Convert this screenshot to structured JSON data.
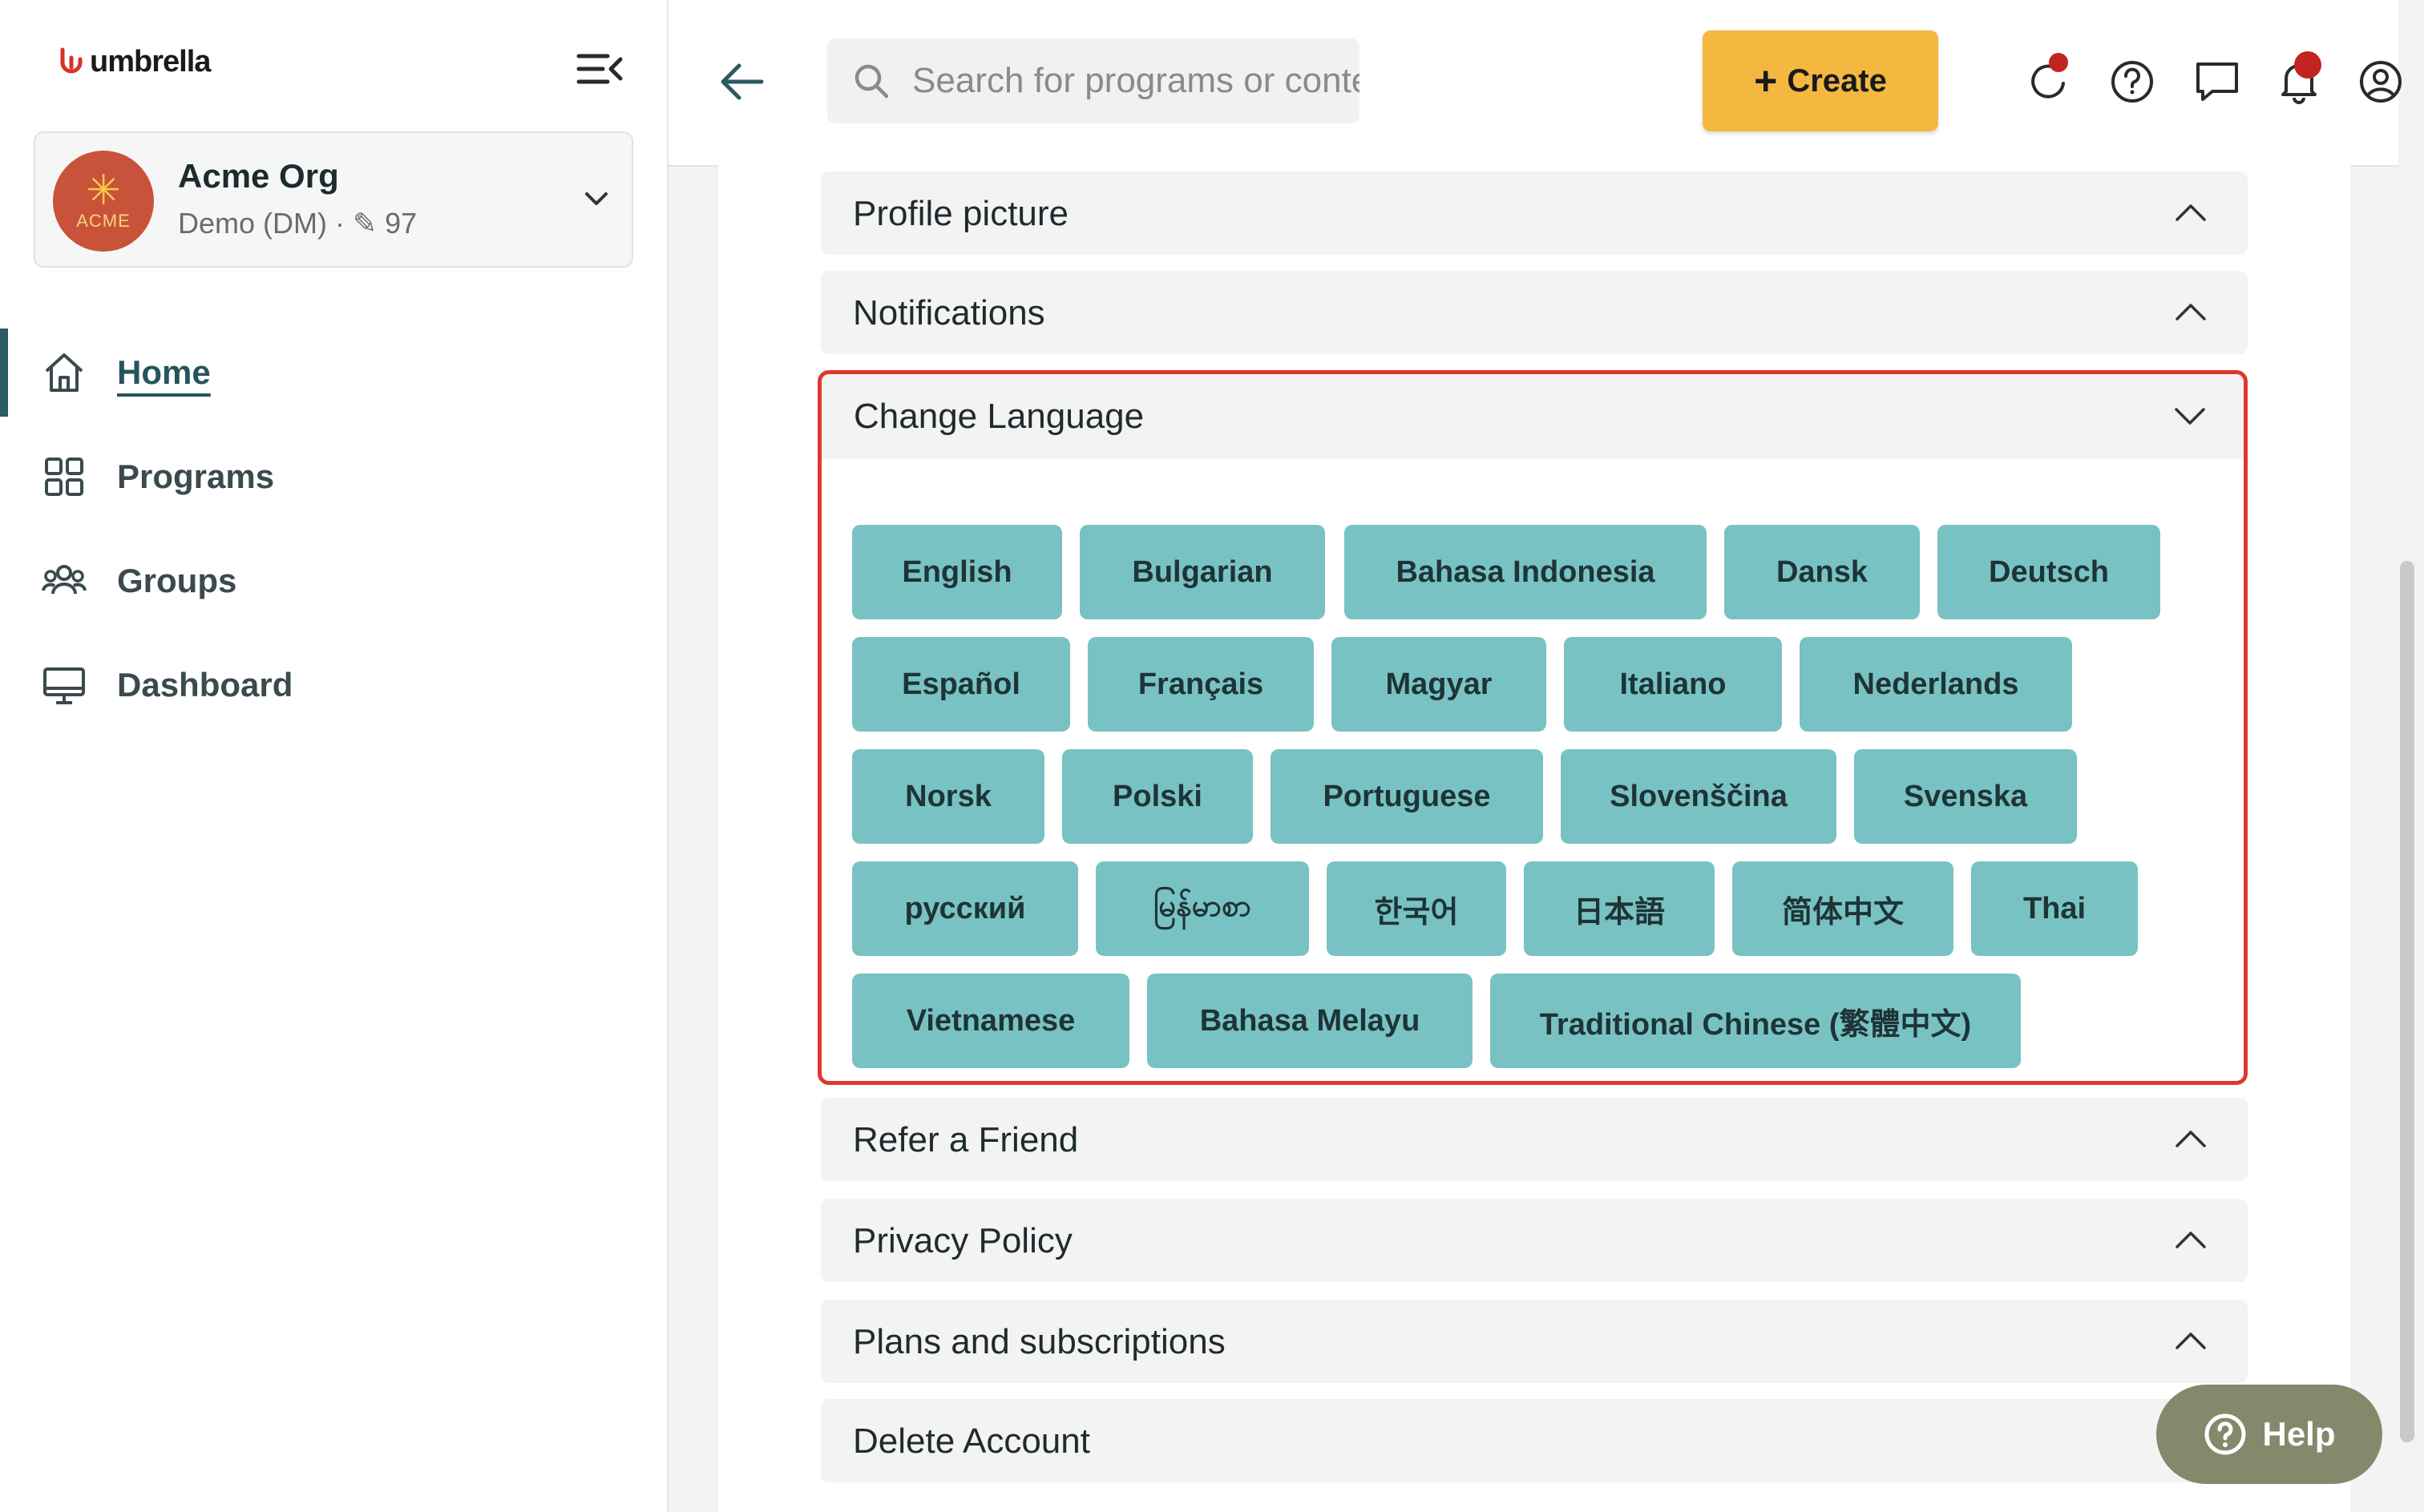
{
  "brand": {
    "name": "umbrella"
  },
  "org": {
    "name": "Acme Org",
    "avatar_text": "ACME",
    "subtitle": "Demo (DM) · ✎ 97"
  },
  "nav": {
    "items": [
      {
        "label": "Home",
        "icon": "home-icon",
        "active": true
      },
      {
        "label": "Programs",
        "icon": "grid-icon",
        "active": false
      },
      {
        "label": "Groups",
        "icon": "users-icon",
        "active": false
      },
      {
        "label": "Dashboard",
        "icon": "monitor-icon",
        "active": false
      }
    ]
  },
  "topbar": {
    "search_placeholder": "Search for programs or content",
    "create_label": "Create",
    "icons": [
      "refresh-icon",
      "help-circle-icon",
      "chat-icon",
      "bell-icon",
      "user-circle-icon"
    ]
  },
  "sections": {
    "profile_picture": "Profile picture",
    "notifications": "Notifications",
    "change_language": "Change Language",
    "refer_a_friend": "Refer a Friend",
    "privacy_policy": "Privacy Policy",
    "plans": "Plans and subscriptions",
    "delete_account": "Delete Account"
  },
  "languages": [
    "English",
    "Bulgarian",
    "Bahasa Indonesia",
    "Dansk",
    "Deutsch",
    "Español",
    "Français",
    "Magyar",
    "Italiano",
    "Nederlands",
    "Norsk",
    "Polski",
    "Portuguese",
    "Slovenščina",
    "Svenska",
    "русский",
    "မြန်မာစာ",
    "한국어",
    "日本語",
    "简体中文",
    "Thai",
    "Vietnamese",
    "Bahasa Melayu",
    "Traditional Chinese (繁體中文)"
  ],
  "help_fab": {
    "label": "Help"
  },
  "colors": {
    "accent_teal": "#79c2c3",
    "create_yellow": "#f4b841",
    "highlight_red": "#e0382c",
    "nav_active": "#2c5b63",
    "notification_dot": "#c3241f"
  }
}
